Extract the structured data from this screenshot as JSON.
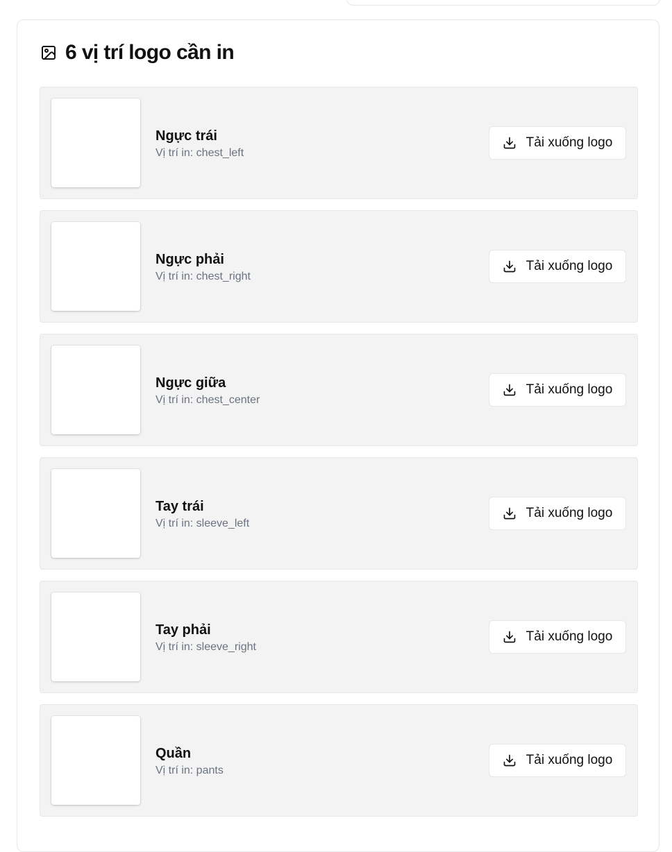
{
  "top": {
    "partial_text": "·    ·   ·     ·",
    "search_value": ""
  },
  "section": {
    "title": "6 vị trí logo cần in",
    "title_icon": "image-icon"
  },
  "positions": [
    {
      "name": "Ngực trái",
      "location": "Vị trí in: chest_left",
      "button": "Tải xuống logo"
    },
    {
      "name": "Ngực phải",
      "location": "Vị trí in: chest_right",
      "button": "Tải xuống logo"
    },
    {
      "name": "Ngực giữa",
      "location": "Vị trí in: chest_center",
      "button": "Tải xuống logo"
    },
    {
      "name": "Tay trái",
      "location": "Vị trí in: sleeve_left",
      "button": "Tải xuống logo"
    },
    {
      "name": "Tay phải",
      "location": "Vị trí in: sleeve_right",
      "button": "Tải xuống logo"
    },
    {
      "name": "Quần",
      "location": "Vị trí in: pants",
      "button": "Tải xuống logo"
    }
  ],
  "colors": {
    "row_bg": "#f3f3f3",
    "border": "#e5e7eb",
    "muted_text": "#6b7280"
  }
}
